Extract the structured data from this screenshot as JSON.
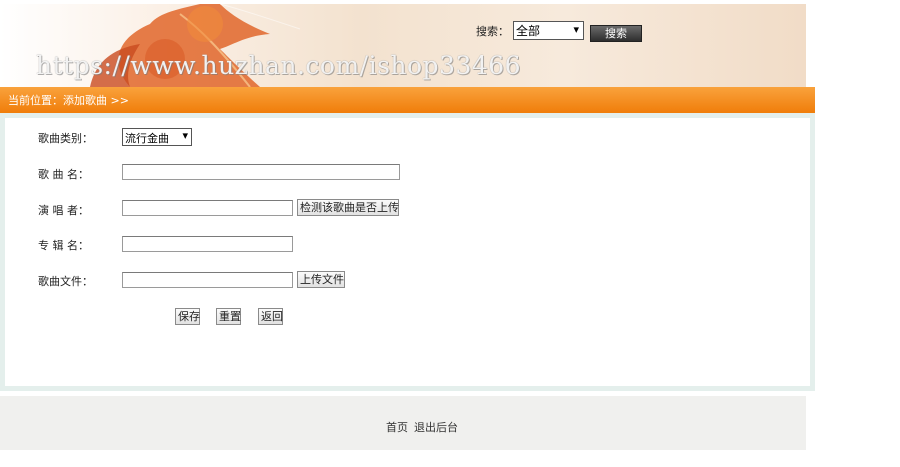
{
  "header": {
    "watermark": "https://www.huzhan.com/ishop33466",
    "search_label": "搜索：",
    "search_scope": "全部",
    "search_button": "搜索"
  },
  "location": {
    "text": "当前位置：添加歌曲 >>"
  },
  "form": {
    "category_label": "歌曲类别：",
    "category_value": "流行金曲",
    "name_label": "歌 曲 名：",
    "singer_label": "演 唱 者：",
    "check_button": "检测该歌曲是否上传",
    "album_label": "专 辑 名：",
    "file_label": "歌曲文件：",
    "upload_button": "上传文件",
    "save_button": "保存",
    "reset_button": "重置",
    "back_button": "返回"
  },
  "footer": {
    "home_link": "首页",
    "logout_link": "退出后台"
  }
}
